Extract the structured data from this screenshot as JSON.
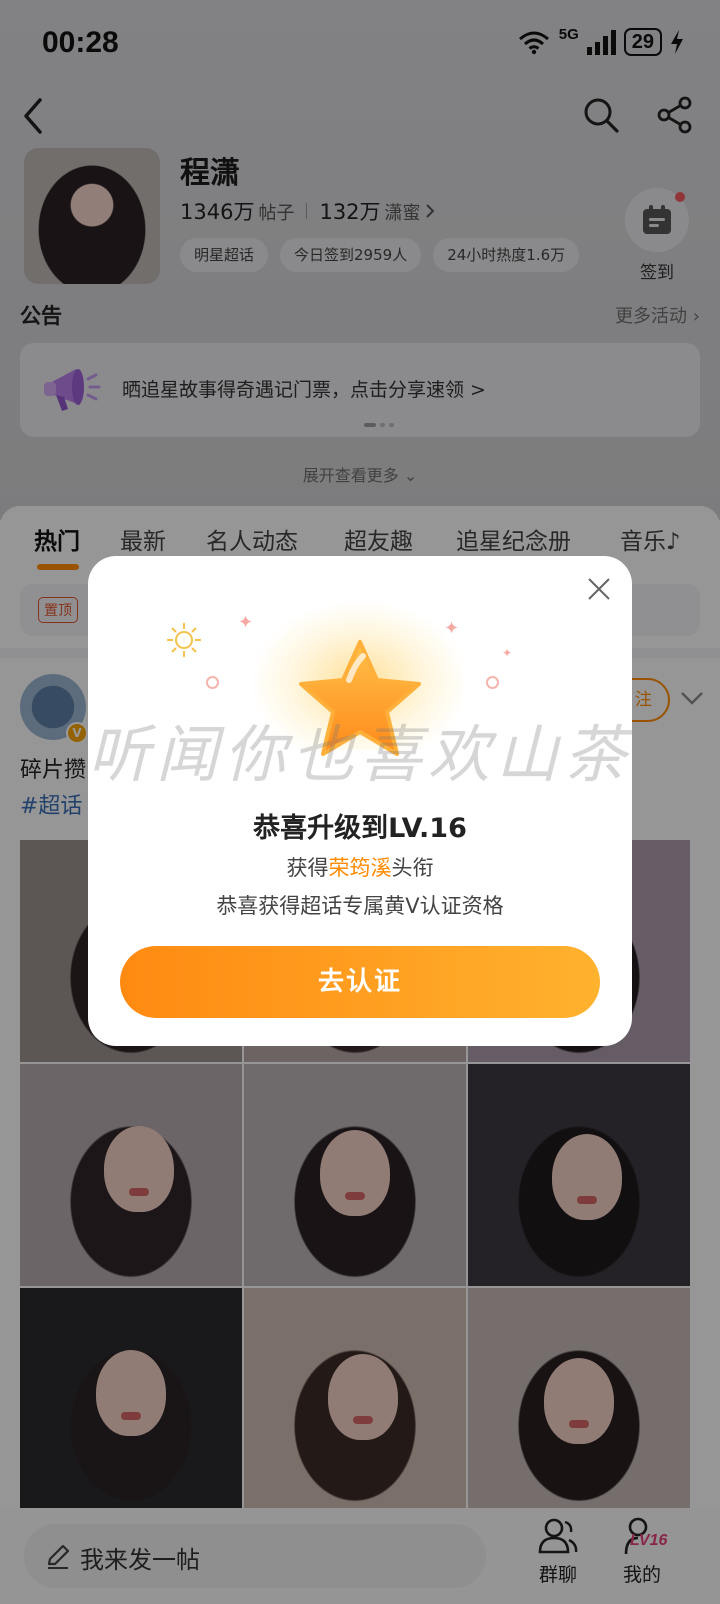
{
  "status_bar": {
    "time": "00:28",
    "network": "5G",
    "battery": "29"
  },
  "profile": {
    "name": "程潇",
    "posts_count": "1346万",
    "posts_label": "帖子",
    "fans_count": "132万",
    "fans_label": "潇蜜",
    "tags": [
      "明星超话",
      "今日签到2959人",
      "24小时热度1.6万"
    ],
    "signin_label": "签到"
  },
  "notice": {
    "title": "公告",
    "more": "更多活动",
    "text": "晒追星故事得奇遇记门票，点击分享速领 >",
    "expand": "展开查看更多"
  },
  "tabs": [
    {
      "label": "热门"
    },
    {
      "label": "最新"
    },
    {
      "label": "名人动态"
    },
    {
      "label": "超友趣"
    },
    {
      "label": "追星纪念册"
    },
    {
      "label": "音乐♪"
    }
  ],
  "pinned": {
    "badge": "置顶"
  },
  "post": {
    "text": "碎片攒",
    "topic": "#超话",
    "follow": "注",
    "verified_badge": "V"
  },
  "bottom_bar": {
    "compose": "我来发一帖",
    "group_chat": "群聊",
    "mine": "我的",
    "level": "LV16"
  },
  "modal": {
    "watermark": "听闻你也喜欢山茶",
    "title": "恭喜升级到LV.16",
    "line1_prefix": "获得",
    "line1_highlight": "荣筠溪",
    "line1_suffix": "头衔",
    "line2": "恭喜获得超话专属黄V认证资格",
    "cta": "去认证"
  },
  "colors": {
    "accent": "#ff8a00",
    "topic_link": "#3a6fb5",
    "badge_red": "#e0552f"
  }
}
